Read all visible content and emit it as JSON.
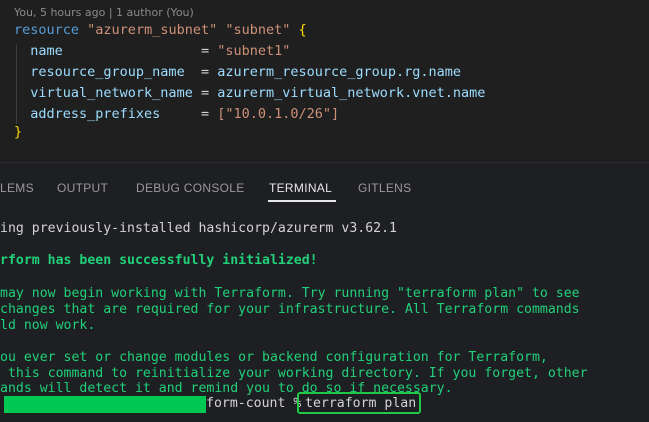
{
  "editor": {
    "blame": "You, 5 hours ago | 1 author (You)",
    "line1": {
      "kw": "resource",
      "s1": "\"azurerm_subnet\"",
      "s2": "\"subnet\"",
      "brace": "{"
    },
    "line2": {
      "attr": "name",
      "pad": "                 = ",
      "val": "\"subnet1\""
    },
    "line3": {
      "attr": "resource_group_name",
      "pad": "  = ",
      "val": "azurerm_resource_group.rg.name"
    },
    "line4": {
      "attr": "virtual_network_name",
      "pad": " = ",
      "val": "azurerm_virtual_network.vnet.name"
    },
    "line5": {
      "attr": "address_prefixes",
      "pad": "     = ",
      "val": "[\"10.0.1.0/26\"]"
    },
    "line6": {
      "brace": "}"
    }
  },
  "panel": {
    "tabs": [
      "LEMS",
      "OUTPUT",
      "DEBUG CONSOLE",
      "TERMINAL",
      "GITLENS"
    ],
    "active_tab": "TERMINAL"
  },
  "terminal": {
    "lines": [
      "ing previously-installed hashicorp/azurerm v3.62.1",
      "rform has been successfully initialized!",
      "may now begin working with Terraform. Try running \"terraform plan\" to see",
      "changes that are required for your infrastructure. All Terraform commands",
      "ld now work.",
      "ou ever set or change modules or backend configuration for Terraform,",
      " this command to reinitialize your working directory. If you forget, other",
      "ands will detect it and remind you to do so if necessary."
    ],
    "prompt_suffix": "form-count % ",
    "command": "terraform plan"
  },
  "colors": {
    "terminal_green": "#21d07a",
    "highlight_box": "#1fc845",
    "redaction": "#00c853"
  }
}
